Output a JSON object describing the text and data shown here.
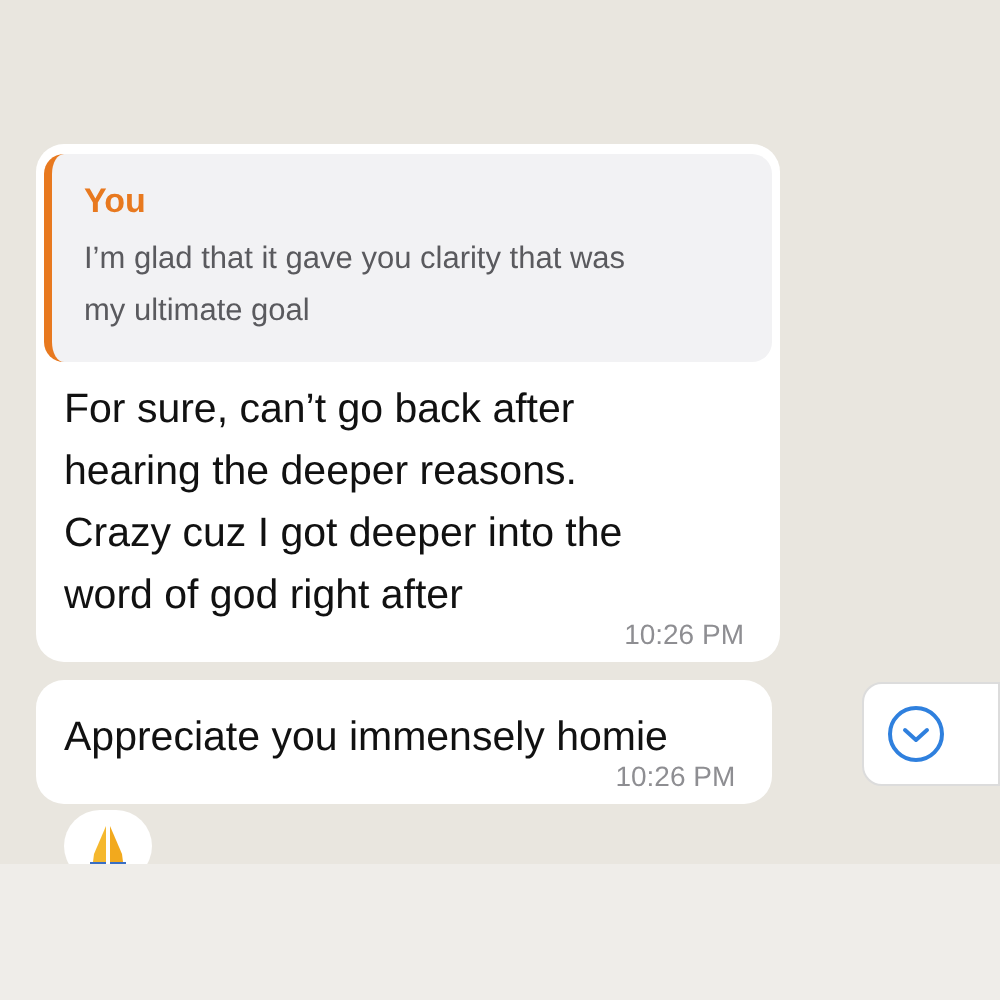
{
  "messages": [
    {
      "quote": {
        "author": "You",
        "text": "I’m glad that it gave you clarity that was my ultimate goal"
      },
      "text": "For sure, can’t go back after hearing the deeper reasons. Crazy cuz I got deeper into the word of god right after",
      "time": "10:26 PM",
      "reacted": false
    },
    {
      "text": "Appreciate you immensely homie",
      "time": "10:26 PM",
      "reacted": true
    }
  ],
  "scroll_down_button": {
    "shown": true
  }
}
